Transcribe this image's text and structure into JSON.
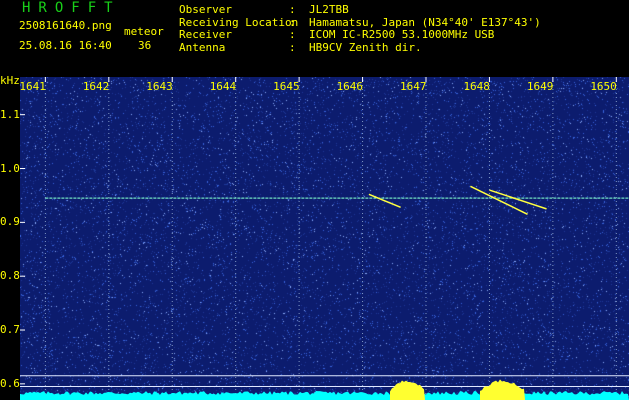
{
  "header": {
    "logo": "HROFFT",
    "filename": "2508161640.png",
    "datetime": "25.08.16 16:40",
    "count_type": "meteor",
    "count": "36",
    "info": [
      {
        "label": "Observer",
        "value": "JL2TBB"
      },
      {
        "label": "Receiving Location",
        "value": "Hamamatsu, Japan (N34°40' E137°43')"
      },
      {
        "label": "Receiver",
        "value": "ICOM IC-R2500 53.1000MHz USB"
      },
      {
        "label": "Antenna",
        "value": "HB9CV Zenith dir."
      }
    ]
  },
  "chart_data": {
    "type": "heatmap",
    "y_unit": "kHz",
    "x_ticks": [
      "1641",
      "1642",
      "1643",
      "1644",
      "1645",
      "1646",
      "1647",
      "1648",
      "1649",
      "1650"
    ],
    "y_ticks": [
      "1.1",
      "1.0",
      "0.9",
      "0.8",
      "0.7",
      "0.6"
    ],
    "ylim": [
      0.57,
      1.17
    ],
    "xlim": [
      1640.6,
      1650.2
    ],
    "carrier_freq": 0.945,
    "meteors": [
      {
        "x0": 1646.1,
        "y0": 0.952,
        "x1": 1646.6,
        "y1": 0.928
      },
      {
        "x0": 1647.7,
        "y0": 0.967,
        "x1": 1648.6,
        "y1": 0.915
      },
      {
        "x0": 1648.0,
        "y0": 0.96,
        "x1": 1648.9,
        "y1": 0.925
      }
    ],
    "colors": {
      "background": "#0c1c6e",
      "noise": "#3a66e0",
      "signal": "#ffff40",
      "grid": "#ffffff",
      "spectrum": "#00ffff"
    }
  }
}
